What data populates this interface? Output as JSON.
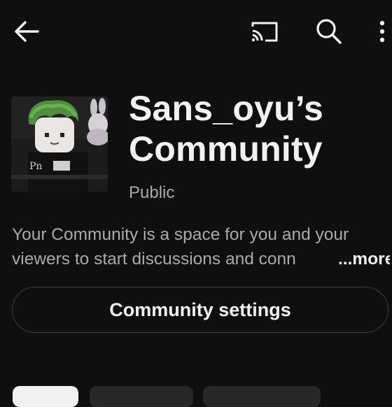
{
  "header": {
    "back_icon": "arrow-left-icon",
    "cast_icon": "cast-icon",
    "search_icon": "search-icon",
    "more_icon": "more-vert-icon"
  },
  "community": {
    "title": "Sans_oyu’s Community",
    "visibility": "Public",
    "description_line1": "Your Community is a space for you and your",
    "description_line2": "viewers to start discussions and conn",
    "more_label": "...more",
    "settings_label": "Community settings",
    "avatar_text": "Pn"
  },
  "colors": {
    "background": "#0f0f0f",
    "primary_text": "#f1f1f1",
    "secondary_text": "#aaaaaa",
    "border": "#3f3f3f"
  }
}
